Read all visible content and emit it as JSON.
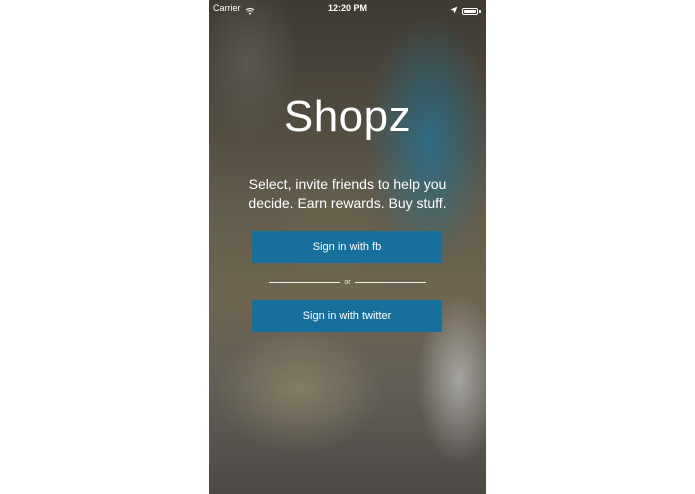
{
  "status_bar": {
    "carrier": "Carrier",
    "time": "12:20 PM"
  },
  "app": {
    "title": "Shopz",
    "tagline": "Select, invite friends to help you decide. Earn rewards. Buy stuff."
  },
  "buttons": {
    "sign_in_fb": "Sign in with fb",
    "or": "or",
    "sign_in_twitter": "Sign in with twitter"
  },
  "colors": {
    "button_bg": "#17709c",
    "text": "#ffffff"
  },
  "icons": {
    "wifi": "wifi-icon",
    "location": "location-arrow-icon",
    "battery": "battery-icon"
  }
}
